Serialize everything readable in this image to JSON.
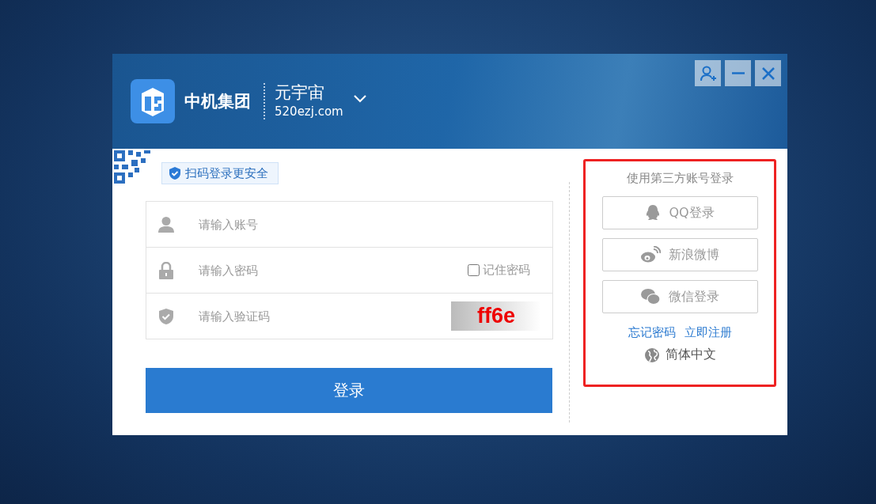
{
  "header": {
    "brand": "中机集团",
    "product": "元宇宙",
    "domain": "520ezj.com"
  },
  "qr_hint": "扫码登录更安全",
  "fields": [
    {
      "kind": "account",
      "placeholder": "请输入账号"
    },
    {
      "kind": "password",
      "placeholder": "请输入密码",
      "remember": {
        "label": "记住密码",
        "checked": false
      }
    },
    {
      "kind": "captcha",
      "placeholder": "请输入验证码",
      "captcha_text": "ff6e"
    }
  ],
  "login_button": "登录",
  "third_party": {
    "title": "使用第三方账号登录",
    "highlighted": true,
    "buttons": [
      {
        "kind": "qq",
        "label": "QQ登录"
      },
      {
        "kind": "weibo",
        "label": "新浪微博"
      },
      {
        "kind": "wechat",
        "label": "微信登录"
      }
    ],
    "links": [
      "忘记密码",
      "立即注册"
    ],
    "language": "简体中文"
  }
}
